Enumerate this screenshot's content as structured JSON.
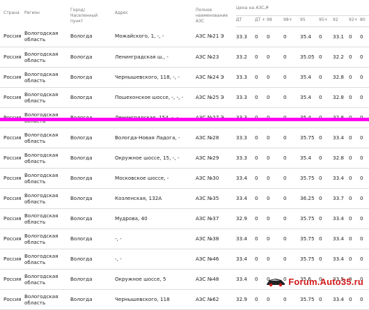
{
  "headers": {
    "country": "Страна",
    "region": "Регион",
    "city": "Город/Населенный пункт",
    "address": "Адрес",
    "name": "Полное наименование АЗС",
    "price_group": "Цена на АЗС,₽",
    "fuels": [
      "ДТ",
      "ДТ +",
      "98",
      "98+",
      "95",
      "95+",
      "92",
      "92+",
      "80"
    ]
  },
  "rows": [
    {
      "country": "Россия",
      "region": "Вологодская область",
      "city": "Вологда",
      "address": "Можайского, 1, -, -",
      "name": "АЗС №21 Э",
      "prices": [
        "33.3",
        "0",
        "0",
        "0",
        "35.4",
        "0",
        "33.1",
        "0",
        "0"
      ]
    },
    {
      "country": "Россия",
      "region": "Вологодская область",
      "city": "Вологда",
      "address": "Ленинградская ш., -",
      "name": "АЗС №23",
      "prices": [
        "33.2",
        "0",
        "0",
        "0",
        "35.05",
        "0",
        "32.2",
        "0",
        "0"
      ]
    },
    {
      "country": "Россия",
      "region": "Вологодская область",
      "city": "Вологда",
      "address": "Чернышевского, 118, -, -",
      "name": "АЗС №24 Э",
      "prices": [
        "33.3",
        "0",
        "0",
        "0",
        "35.4",
        "0",
        "32.8",
        "0",
        "0"
      ]
    },
    {
      "country": "Россия",
      "region": "Вологодская область",
      "city": "Вологда",
      "address": "Пошехонское шоссе, -, -, -",
      "name": "АЗС №25 Э",
      "prices": [
        "33.3",
        "0",
        "0",
        "0",
        "35.4",
        "0",
        "32.8",
        "0",
        "0"
      ]
    },
    {
      "country": "Россия",
      "region": "Вологодская область",
      "city": "Вологда",
      "address": "Ленинградская, 154, -, -",
      "name": "АЗС №27 Э",
      "prices": [
        "33.3",
        "0",
        "0",
        "0",
        "35.4",
        "0",
        "32.8",
        "0",
        "0"
      ]
    },
    {
      "country": "Россия",
      "region": "Вологодская область",
      "city": "Вологда",
      "address": "Вологда-Новая Ладога, -",
      "name": "АЗС №28",
      "prices": [
        "33.3",
        "0",
        "0",
        "0",
        "35.75",
        "0",
        "33.4",
        "0",
        "0"
      ]
    },
    {
      "country": "Россия",
      "region": "Вологодская область",
      "city": "Вологда",
      "address": "Окружное шоссе, 15, -, -",
      "name": "АЗС №29",
      "prices": [
        "33.3",
        "0",
        "0",
        "0",
        "35.4",
        "0",
        "32.8",
        "0",
        "0"
      ]
    },
    {
      "country": "Россия",
      "region": "Вологодская область",
      "city": "Вологда",
      "address": "Московское шоссе, -",
      "name": "АЗС №30",
      "prices": [
        "33.4",
        "0",
        "0",
        "0",
        "35.75",
        "0",
        "33.4",
        "0",
        "0"
      ]
    },
    {
      "country": "Россия",
      "region": "Вологодская область",
      "city": "Вологда",
      "address": "Козленская, 132А",
      "name": "АЗС №35",
      "prices": [
        "33.4",
        "0",
        "0",
        "0",
        "36.25",
        "0",
        "33.7",
        "0",
        "0"
      ]
    },
    {
      "country": "Россия",
      "region": "Вологодская область",
      "city": "Вологда",
      "address": "Мудрова, 40",
      "name": "АЗС №37",
      "prices": [
        "32.9",
        "0",
        "0",
        "0",
        "35.75",
        "0",
        "33.4",
        "0",
        "0"
      ]
    },
    {
      "country": "Россия",
      "region": "Вологодская область",
      "city": "Вологда",
      "address": "-, -",
      "name": "АЗС №38",
      "prices": [
        "33.4",
        "0",
        "0",
        "0",
        "35.75",
        "0",
        "33.4",
        "0",
        "0"
      ]
    },
    {
      "country": "Россия",
      "region": "Вологодская область",
      "city": "Вологда",
      "address": "-, -",
      "name": "АЗС №46",
      "prices": [
        "33.4",
        "0",
        "0",
        "0",
        "35.75",
        "0",
        "33.4",
        "0",
        "0"
      ]
    },
    {
      "country": "Россия",
      "region": "Вологодская область",
      "city": "Вологда",
      "address": "Окружное шоссе, 5",
      "name": "АЗС №48",
      "prices": [
        "33.4",
        "0",
        "0",
        "0",
        "35.6",
        "0",
        "33.5",
        "0",
        "0"
      ]
    },
    {
      "country": "Россия",
      "region": "Вологодская область",
      "city": "Вологда",
      "address": "Чернышевского, 118",
      "name": "АЗС №62",
      "prices": [
        "32.9",
        "0",
        "0",
        "0",
        "35.75",
        "0",
        "33.4",
        "0",
        "0"
      ]
    }
  ],
  "watermark": {
    "text": "Forum.Auto35.ru",
    "color": "#d11818"
  },
  "highlight": {
    "color": "#ff00f2"
  }
}
